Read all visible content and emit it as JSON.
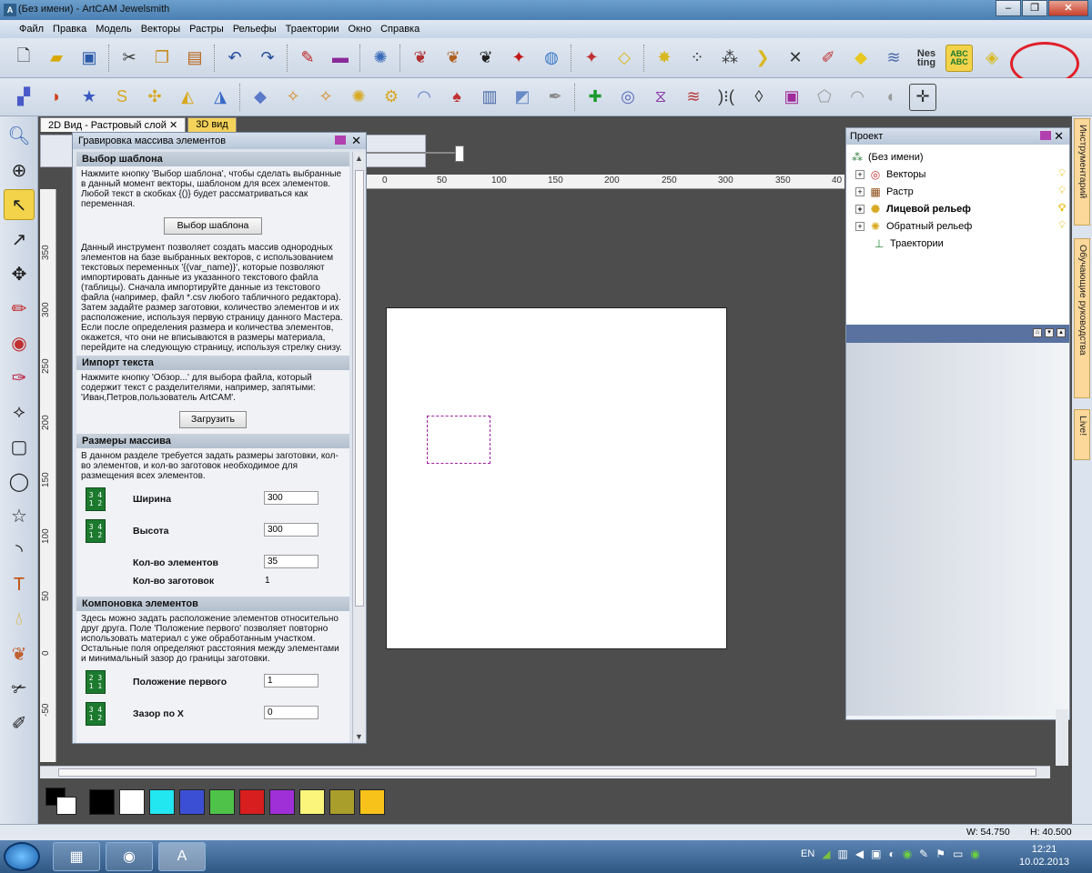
{
  "window": {
    "title": "(Без имени) - ArtCAM Jewelsmith"
  },
  "menu": [
    "Файл",
    "Правка",
    "Модель",
    "Векторы",
    "Растры",
    "Рельефы",
    "Траектории",
    "Окно",
    "Справка"
  ],
  "view_tabs": {
    "tab1": "2D Вид - Растровый слой",
    "tab2": "3D вид"
  },
  "ruler": {
    "top": [
      "0",
      "50",
      "100",
      "150",
      "200",
      "250",
      "300",
      "350",
      "40"
    ],
    "left": [
      "350",
      "300",
      "250",
      "200",
      "150",
      "100",
      "50",
      "0",
      "-50"
    ]
  },
  "dialog": {
    "title": "Гравировка массива элементов",
    "sec1": "Выбор шаблона",
    "sec1_text": "Нажмите кнопку 'Выбор шаблона', чтобы сделать выбранные в данный момент векторы, шаблоном для всех элементов. Любой текст в скобках {()} будет рассматриваться как переменная.",
    "template_button": "Выбор шаблона",
    "sec1_text2": "Данный инструмент позволяет создать массив однородных элементов на базе выбранных векторов, с использованием текстовых переменных '{(var_name)}', которые позволяют импортировать данные из указанного текстового файла (таблицы). Сначала импортируйте данные из текстового файла (например, файл *.csv любого табличного редактора). Затем задайте размер заготовки, количество элементов и их расположение, используя первую страницу данного Мастера. Если после определения размера и количества элементов, окажется, что они не вписываются в размеры материала, перейдите на следующую страницу, используя стрелку снизу.",
    "sec2": "Импорт текста",
    "sec2_text": "Нажмите кнопку 'Обзор...' для выбора файла, который содержит текст с разделителями, например, запятыми: 'Иван,Петров,пользователь ArtCAM'.",
    "load_button": "Загрузить",
    "sec3": "Размеры массива",
    "sec3_text": "В данном разделе требуется задать размеры заготовки, кол-во элементов, и кол-во заготовок необходимое для размещения всех элементов.",
    "width_label": "Ширина",
    "width_value": "300",
    "height_label": "Высота",
    "height_value": "300",
    "count_label": "Кол-во элементов",
    "count_value": "35",
    "blanks_label": "Кол-во заготовок",
    "blanks_value": "1",
    "sec4": "Компоновка элементов",
    "sec4_text": "Здесь можно задать расположение элементов относительно друг друга. Поле 'Положение первого' позволяет повторно использовать материал с уже обработанным участком. Остальные поля определяют расстояния между элементами и минимальный зазор до границы заготовки.",
    "first_label": "Положение первого",
    "first_value": "1",
    "gapx_label": "Зазор по X",
    "gapx_value": "0"
  },
  "project": {
    "title": "Проект",
    "root": "(Без имени)",
    "items": [
      "Векторы",
      "Растр",
      "Лицевой рельеф",
      "Обратный рельеф",
      "Траектории"
    ]
  },
  "side_tabs": [
    "Инструментарий",
    "Обучающие руководства",
    "Live!"
  ],
  "status": {
    "w": "W: 54.750",
    "h": "H: 40.500"
  },
  "taskbar": {
    "lang": "EN",
    "time": "12:21",
    "date": "10.02.2013"
  },
  "palette_colors": [
    "#000000",
    "#ffffff",
    "#22e6f0",
    "#3b4fd4",
    "#4fc24a",
    "#d81e1e",
    "#9f2fd6",
    "#fbf57c",
    "#a99d2c",
    "#f7c21a"
  ]
}
